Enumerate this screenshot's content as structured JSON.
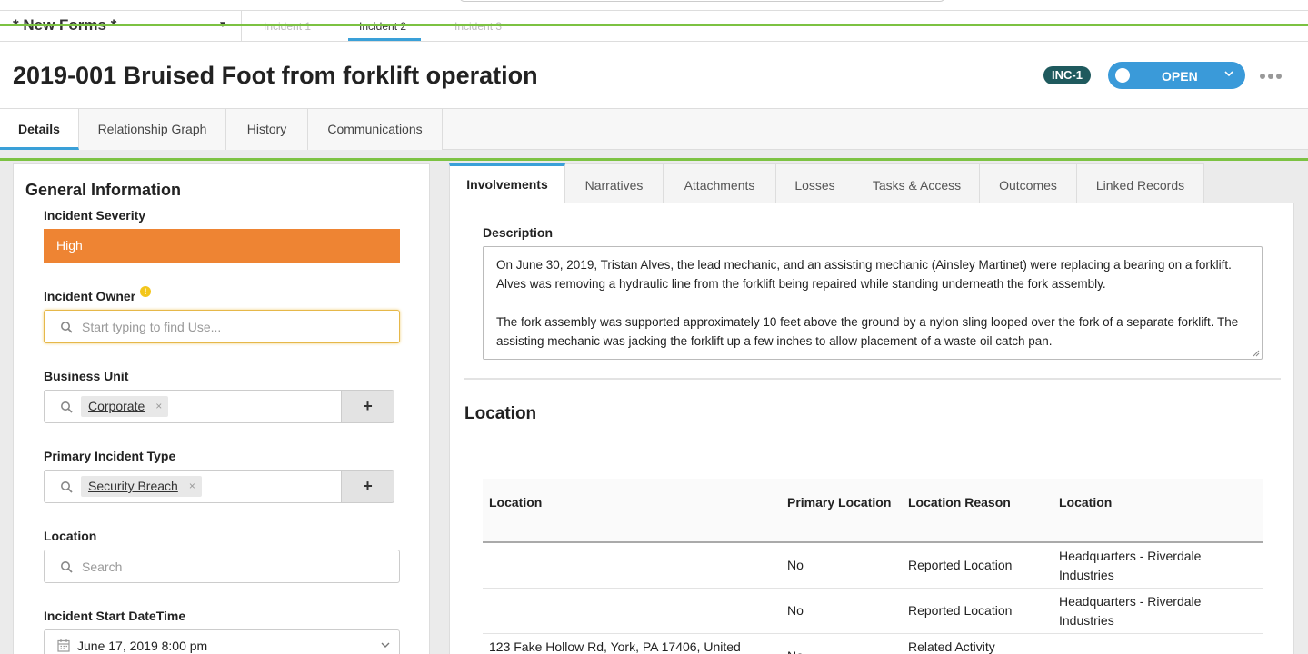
{
  "form_bar": {
    "form_select_label": "* New Forms *",
    "tabs": [
      "Incident 1",
      "Incident 2",
      "Incident 3"
    ],
    "active_tab": "Incident 2"
  },
  "header": {
    "title": "2019-001 Bruised Foot from forklift operation",
    "badge": "INC-1",
    "status": "OPEN"
  },
  "record_tabs": [
    "Details",
    "Relationship Graph",
    "History",
    "Communications"
  ],
  "general_info": {
    "title": "General Information",
    "severity_label": "Incident Severity",
    "severity_value": "High",
    "owner_label": "Incident Owner",
    "owner_placeholder": "Start typing to find Use...",
    "business_unit_label": "Business Unit",
    "business_unit_chip": "Corporate",
    "incident_type_label": "Primary Incident Type",
    "incident_type_chip": "Security Breach",
    "location_label": "Location",
    "location_placeholder": "Search",
    "start_label": "Incident Start DateTime",
    "start_value": "June 17, 2019 8:00 pm"
  },
  "sub_tabs": [
    "Involvements",
    "Narratives",
    "Attachments",
    "Losses",
    "Tasks & Access",
    "Outcomes",
    "Linked Records"
  ],
  "description": {
    "label": "Description",
    "paragraph1": "On June 30, 2019, Tristan Alves, the lead mechanic, and an assisting mechanic (Ainsley Martinet) were replacing a bearing on a forklift. Alves was removing a hydraulic line from the forklift being repaired while standing underneath the fork assembly.",
    "paragraph2": "The fork assembly was supported approximately 10 feet above the ground by a nylon sling looped over the fork of a separate forklift. The assisting mechanic was jacking the forklift up a few inches to allow placement of a waste oil catch pan."
  },
  "location_section": {
    "title": "Location",
    "columns": [
      "Location",
      "Primary Location",
      "Location Reason",
      "Location"
    ],
    "rows": [
      {
        "location": "",
        "primary": "No",
        "reason": "Reported Location",
        "site_line1": "Headquarters - Riverdale",
        "site_line2": "Industries"
      },
      {
        "location": "",
        "primary": "No",
        "reason": "Reported Location",
        "site_line1": "Headquarters - Riverdale",
        "site_line2": "Industries"
      },
      {
        "location": "123 Fake Hollow Rd, York, PA 17406, United",
        "primary": "No",
        "reason": "Related Activity",
        "site_line1": "",
        "site_line2": ""
      }
    ]
  },
  "colors": {
    "accent": "#3aa0d8",
    "green_line": "#7cc242",
    "severity_high": "#ee8433",
    "badge": "#1f5a5e",
    "status": "#3a9ad9"
  },
  "icons": [
    "search-icon",
    "calendar-icon",
    "chevron-down-icon",
    "more-icon",
    "warning-icon",
    "close-icon",
    "plus-icon"
  ]
}
